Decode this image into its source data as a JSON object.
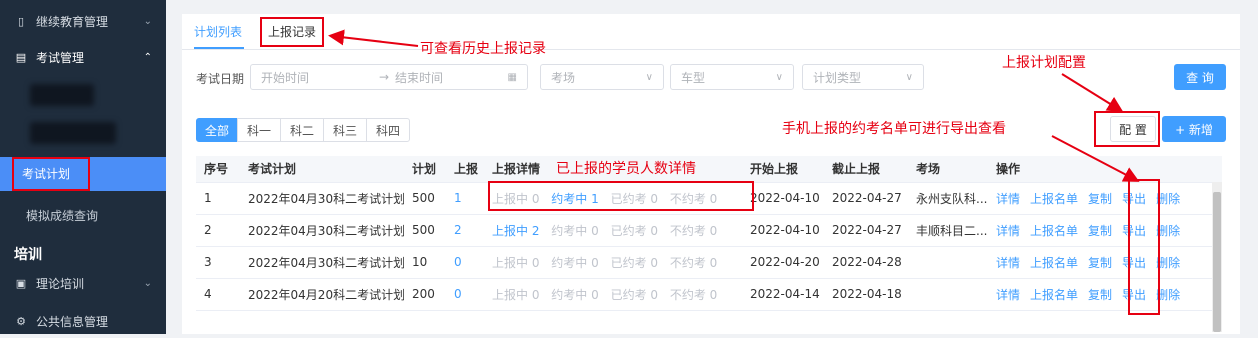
{
  "sidebar": {
    "menu1_label": "继续教育管理",
    "menu2_label": "考试管理",
    "active_item": "考试计划",
    "sub_item": "模拟成绩查询",
    "section_heading": "培训",
    "menu3_label": "理论培训",
    "menu4_label": "公共信息管理"
  },
  "tabs": {
    "plan_list": "计划列表",
    "report_records": "上报记录"
  },
  "filters": {
    "exam_date_label": "考试日期",
    "start_placeholder": "开始时间",
    "end_placeholder": "结束时间",
    "range_sep": "→",
    "exam_site_placeholder": "考场",
    "car_type_placeholder": "车型",
    "plan_type_placeholder": "计划类型",
    "query_button": "查 询"
  },
  "segments": [
    "全部",
    "科一",
    "科二",
    "科三",
    "科四"
  ],
  "actions": {
    "config_button": "配 置",
    "add_button": "+ 新增"
  },
  "table": {
    "headers": [
      "序号",
      "考试计划",
      "计划",
      "上报",
      "上报详情",
      "开始上报",
      "截止上报",
      "考场",
      "操作"
    ],
    "rows": [
      {
        "no": "1",
        "plan": "2022年04月30科二考试计划",
        "planned": "500",
        "reported": "1",
        "d1": "上报中 0",
        "d2": "约考中 1",
        "d3": "已约考 0",
        "d4": "不约考 0",
        "start": "2022-04-10",
        "end": "2022-04-27",
        "site": "永州支队科..."
      },
      {
        "no": "2",
        "plan": "2022年04月30科二考试计划",
        "planned": "500",
        "reported": "2",
        "d1": "上报中 2",
        "d2": "约考中 0",
        "d3": "已约考 0",
        "d4": "不约考 0",
        "start": "2022-04-10",
        "end": "2022-04-27",
        "site": "丰顺科目二..."
      },
      {
        "no": "3",
        "plan": "2022年04月30科二考试计划",
        "planned": "10",
        "reported": "0",
        "d1": "上报中 0",
        "d2": "约考中 0",
        "d3": "已约考 0",
        "d4": "不约考 0",
        "start": "2022-04-20",
        "end": "2022-04-28",
        "site": ""
      },
      {
        "no": "4",
        "plan": "2022年04月20科二考试计划",
        "planned": "200",
        "reported": "0",
        "d1": "上报中 0",
        "d2": "约考中 0",
        "d3": "已约考 0",
        "d4": "不约考 0",
        "start": "2022-04-14",
        "end": "2022-04-18",
        "site": ""
      }
    ],
    "ops": [
      "详情",
      "上报名单",
      "复制",
      "导出",
      "删除"
    ]
  },
  "annotations": {
    "history": "可查看历史上报记录",
    "config": "上报计划配置",
    "export": "手机上报的约考名单可进行导出查看",
    "detail": "已上报的学员人数详情"
  },
  "colors": {
    "accent": "#409eff",
    "annotation_red": "#e60012",
    "sidebar_bg": "#1f2d3d"
  }
}
